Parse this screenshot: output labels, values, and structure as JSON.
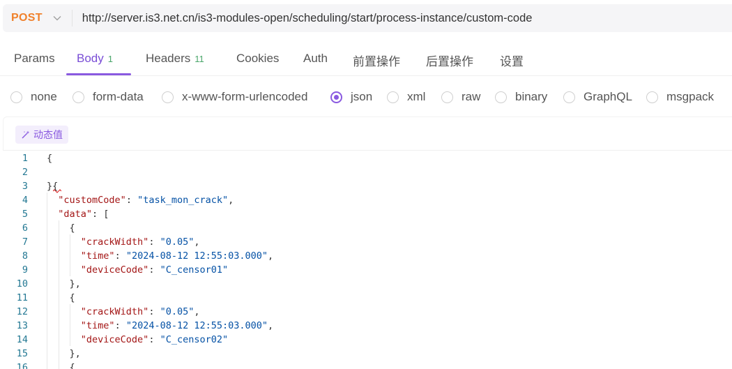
{
  "request": {
    "method": "POST",
    "url": "http://server.is3.net.cn/is3-modules-open/scheduling/start/process-instance/custom-code"
  },
  "tabs": [
    {
      "label": "Params",
      "count": ""
    },
    {
      "label": "Body",
      "count": "1"
    },
    {
      "label": "Headers",
      "count": "11"
    },
    {
      "label": "Cookies",
      "count": ""
    },
    {
      "label": "Auth",
      "count": ""
    },
    {
      "label": "前置操作",
      "count": ""
    },
    {
      "label": "后置操作",
      "count": ""
    },
    {
      "label": "设置",
      "count": ""
    }
  ],
  "active_tab": "Body",
  "body_types": [
    "none",
    "form-data",
    "x-www-form-urlencoded",
    "json",
    "xml",
    "raw",
    "binary",
    "GraphQL",
    "msgpack"
  ],
  "selected_body_type": "json",
  "dynamic_value_label": "动态值",
  "accent_color": "#8a5ae0",
  "method_color": "#f0812c",
  "editor": {
    "line_numbers": [
      "1",
      "2",
      "3",
      "4",
      "5",
      "6",
      "7",
      "8",
      "9",
      "10",
      "11",
      "12",
      "13",
      "14",
      "15",
      "16"
    ],
    "lines": [
      [
        {
          "t": "{",
          "c": "p"
        }
      ],
      [],
      [
        {
          "t": "}{",
          "c": "p"
        }
      ],
      [
        {
          "t": "  ",
          "c": "p"
        },
        {
          "t": "\"customCode\"",
          "c": "key"
        },
        {
          "t": ": ",
          "c": "p"
        },
        {
          "t": "\"task_mon_crack\"",
          "c": "str"
        },
        {
          "t": ",",
          "c": "p"
        }
      ],
      [
        {
          "t": "  ",
          "c": "p"
        },
        {
          "t": "\"data\"",
          "c": "key"
        },
        {
          "t": ": [",
          "c": "p"
        }
      ],
      [
        {
          "t": "    {",
          "c": "p"
        }
      ],
      [
        {
          "t": "      ",
          "c": "p"
        },
        {
          "t": "\"crackWidth\"",
          "c": "key"
        },
        {
          "t": ": ",
          "c": "p"
        },
        {
          "t": "\"0.05\"",
          "c": "str"
        },
        {
          "t": ",",
          "c": "p"
        }
      ],
      [
        {
          "t": "      ",
          "c": "p"
        },
        {
          "t": "\"time\"",
          "c": "key"
        },
        {
          "t": ": ",
          "c": "p"
        },
        {
          "t": "\"2024-08-12 12:55:03.000\"",
          "c": "str"
        },
        {
          "t": ",",
          "c": "p"
        }
      ],
      [
        {
          "t": "      ",
          "c": "p"
        },
        {
          "t": "\"deviceCode\"",
          "c": "key"
        },
        {
          "t": ": ",
          "c": "p"
        },
        {
          "t": "\"C_censor01\"",
          "c": "str"
        }
      ],
      [
        {
          "t": "    },",
          "c": "p"
        }
      ],
      [
        {
          "t": "    {",
          "c": "p"
        }
      ],
      [
        {
          "t": "      ",
          "c": "p"
        },
        {
          "t": "\"crackWidth\"",
          "c": "key"
        },
        {
          "t": ": ",
          "c": "p"
        },
        {
          "t": "\"0.05\"",
          "c": "str"
        },
        {
          "t": ",",
          "c": "p"
        }
      ],
      [
        {
          "t": "      ",
          "c": "p"
        },
        {
          "t": "\"time\"",
          "c": "key"
        },
        {
          "t": ": ",
          "c": "p"
        },
        {
          "t": "\"2024-08-12 12:55:03.000\"",
          "c": "str"
        },
        {
          "t": ",",
          "c": "p"
        }
      ],
      [
        {
          "t": "      ",
          "c": "p"
        },
        {
          "t": "\"deviceCode\"",
          "c": "key"
        },
        {
          "t": ": ",
          "c": "p"
        },
        {
          "t": "\"C_censor02\"",
          "c": "str"
        }
      ],
      [
        {
          "t": "    },",
          "c": "p"
        }
      ],
      [
        {
          "t": "    {",
          "c": "p"
        }
      ]
    ]
  }
}
